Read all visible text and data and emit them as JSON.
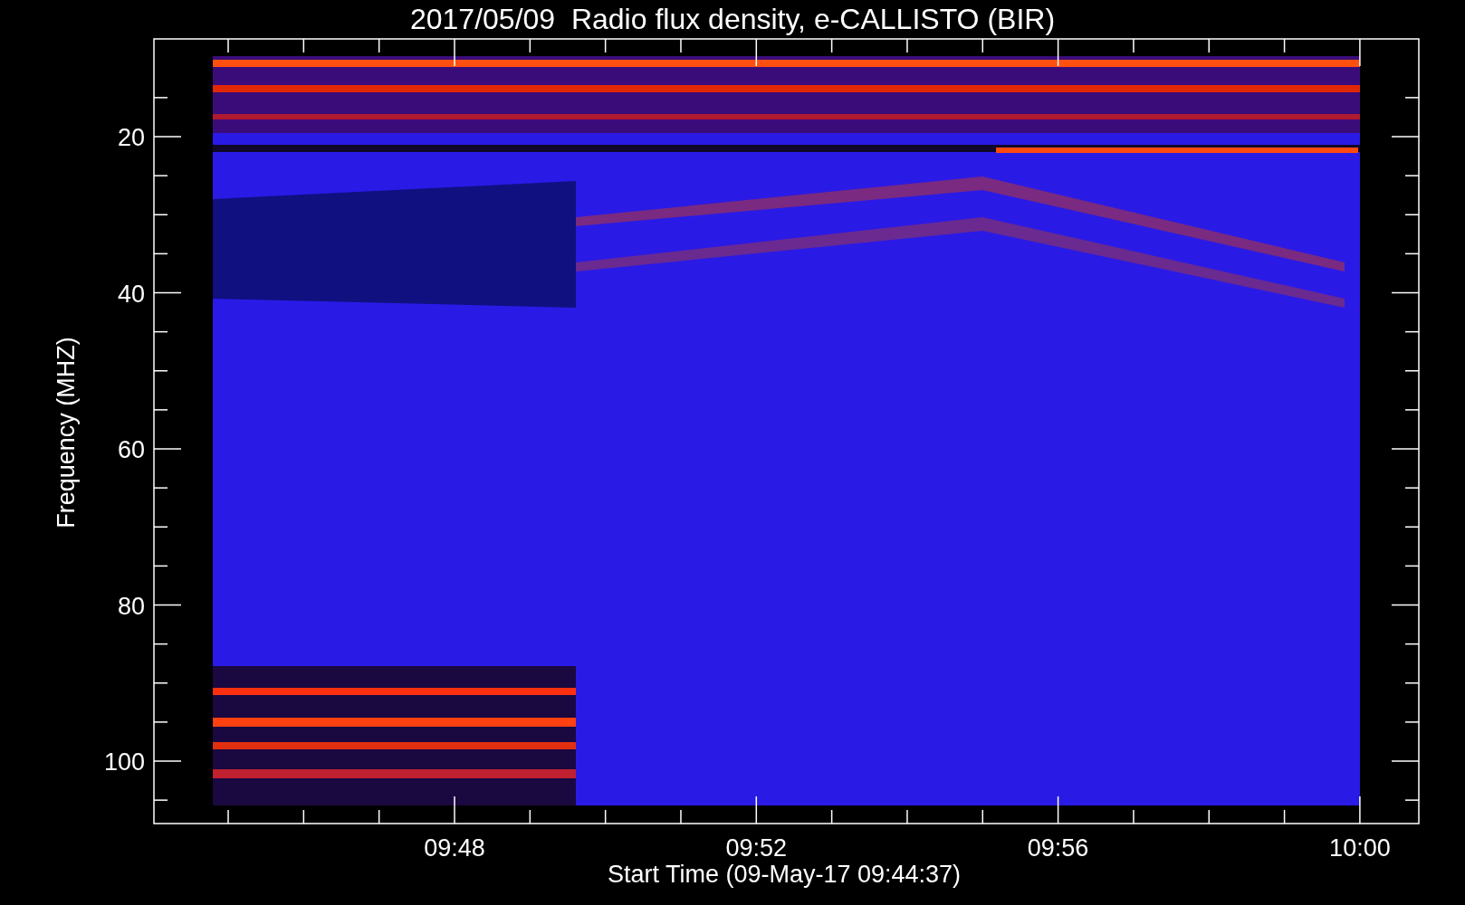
{
  "title": "2017/05/09  Radio flux density, e-CALLISTO (BIR)",
  "y_axis": {
    "label": "Frequency (MHZ)",
    "ticks": [
      "20",
      "40",
      "60",
      "80",
      "100"
    ]
  },
  "x_axis": {
    "label": "Start Time (09-May-17 09:44:37)",
    "ticks": [
      "09:48",
      "09:52",
      "09:56",
      "10:00"
    ]
  }
}
